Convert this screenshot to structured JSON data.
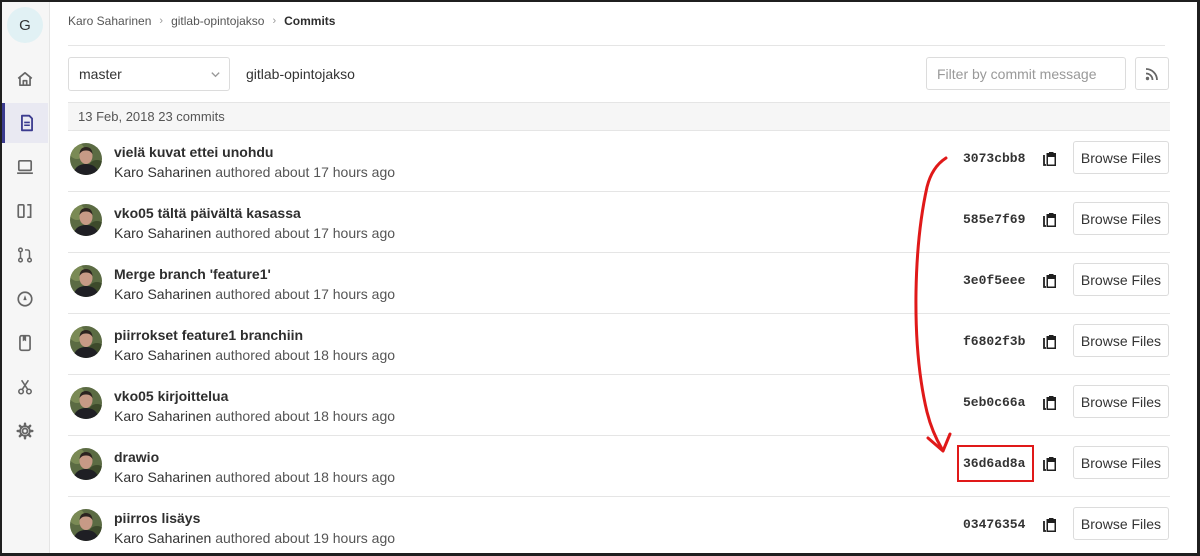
{
  "project": {
    "avatar_letter": "G"
  },
  "sidebar": {
    "items": [
      {
        "name": "home-icon"
      },
      {
        "name": "document-icon"
      },
      {
        "name": "laptop-icon"
      },
      {
        "name": "issues-board-icon"
      },
      {
        "name": "merge-request-icon"
      },
      {
        "name": "rocket-icon"
      },
      {
        "name": "wiki-icon"
      },
      {
        "name": "scissors-icon"
      },
      {
        "name": "gear-icon"
      }
    ]
  },
  "breadcrumb": {
    "user": "Karo Saharinen",
    "project": "gitlab-opintojakso",
    "current": "Commits"
  },
  "controls": {
    "branch": "master",
    "project_path": "gitlab-opintojakso",
    "filter_placeholder": "Filter by commit message"
  },
  "day_header": "13 Feb, 2018 23 commits",
  "commits": [
    {
      "title": "vielä kuvat ettei unohdu",
      "author": "Karo Saharinen",
      "action": "authored",
      "time": "about 17 hours ago",
      "sha": "3073cbb8",
      "browse_label": "Browse Files"
    },
    {
      "title": "vko05 tältä päivältä kasassa",
      "author": "Karo Saharinen",
      "action": "authored",
      "time": "about 17 hours ago",
      "sha": "585e7f69",
      "browse_label": "Browse Files"
    },
    {
      "title": "Merge branch 'feature1'",
      "author": "Karo Saharinen",
      "action": "authored",
      "time": "about 17 hours ago",
      "sha": "3e0f5eee",
      "browse_label": "Browse Files"
    },
    {
      "title": "piirrokset feature1 branchiin",
      "author": "Karo Saharinen",
      "action": "authored",
      "time": "about 18 hours ago",
      "sha": "f6802f3b",
      "browse_label": "Browse Files"
    },
    {
      "title": "vko05 kirjoittelua",
      "author": "Karo Saharinen",
      "action": "authored",
      "time": "about 18 hours ago",
      "sha": "5eb0c66a",
      "browse_label": "Browse Files"
    },
    {
      "title": "drawio",
      "author": "Karo Saharinen",
      "action": "authored",
      "time": "about 18 hours ago",
      "sha": "36d6ad8a",
      "browse_label": "Browse Files"
    },
    {
      "title": "piirros lisäys",
      "author": "Karo Saharinen",
      "action": "authored",
      "time": "about 19 hours ago",
      "sha": "03476354",
      "browse_label": "Browse Files"
    }
  ],
  "colors": {
    "annotation": "#e01919",
    "sidebar_active": "#3b3b8f"
  }
}
